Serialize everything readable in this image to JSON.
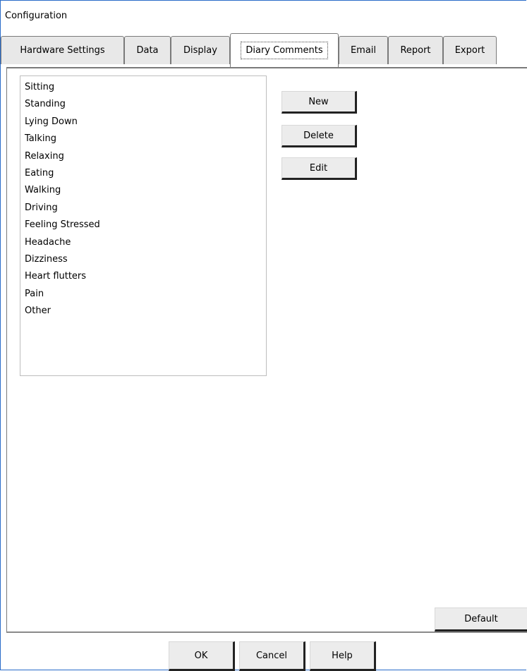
{
  "window": {
    "title": "Configuration"
  },
  "tabs": [
    {
      "label": "Hardware Settings"
    },
    {
      "label": "Data"
    },
    {
      "label": "Display"
    },
    {
      "label": "Diary Comments"
    },
    {
      "label": "Email"
    },
    {
      "label": "Report"
    },
    {
      "label": "Export"
    }
  ],
  "active_tab": "Diary Comments",
  "comments_list": {
    "items": [
      "Sitting",
      "Standing",
      "Lying Down",
      "Talking",
      "Relaxing",
      "Eating",
      "Walking",
      "Driving",
      "Feeling Stressed",
      "Headache",
      "Dizziness",
      "Heart flutters",
      "Pain",
      "Other"
    ]
  },
  "panel_buttons": {
    "new": "New",
    "delete": "Delete",
    "edit": "Edit",
    "default": "Default"
  },
  "dialog_buttons": {
    "ok": "OK",
    "cancel": "Cancel",
    "help": "Help"
  }
}
